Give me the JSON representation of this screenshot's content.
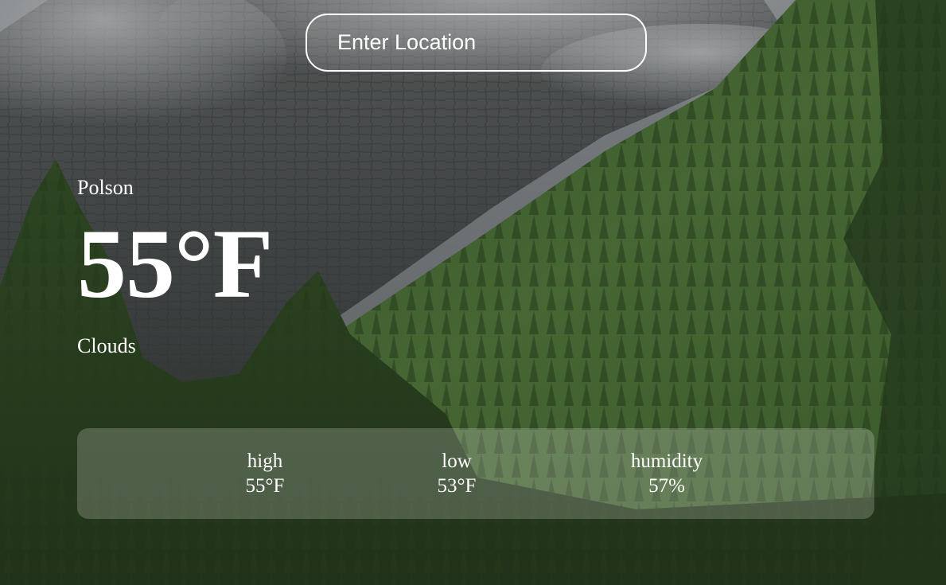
{
  "search": {
    "placeholder": "Enter Location"
  },
  "weather": {
    "location": "Polson",
    "temperature": "55°F",
    "description": "Clouds"
  },
  "stats": {
    "high_label": "high",
    "high_value": "55°F",
    "low_label": "low",
    "low_value": "53°F",
    "humidity_label": "humidity",
    "humidity_value": "57%"
  },
  "colors": {
    "text": "#ffffff",
    "forest": "#4a6f36",
    "rock": "#5d6060",
    "mist": "#bfc3c6"
  }
}
